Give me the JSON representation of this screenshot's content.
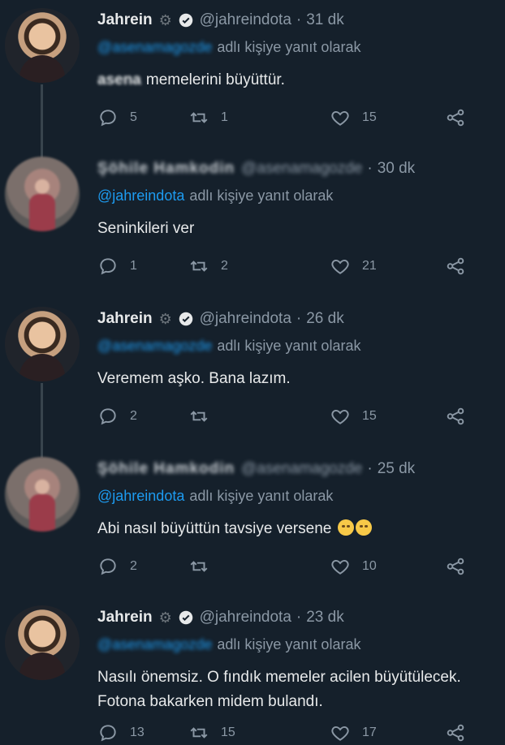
{
  "tweets": [
    {
      "author": "Jahrein",
      "handle": "@jahreindota",
      "time": "31 dk",
      "reply_to": "@asenamagozde",
      "reply_suffix": "adlı kişiye yanıt olarak",
      "text_prefix": "asena",
      "text": "memelerini büyüttür.",
      "replies": "5",
      "retweets": "1",
      "likes": "15"
    },
    {
      "author": "Şöhile Hamkodin",
      "handle": "@asenamagozde",
      "time": "30 dk",
      "reply_to": "@jahreindota",
      "reply_suffix": "adlı kişiye yanıt olarak",
      "text": "Seninkileri ver",
      "replies": "1",
      "retweets": "2",
      "likes": "21"
    },
    {
      "author": "Jahrein",
      "handle": "@jahreindota",
      "time": "26 dk",
      "reply_to": "@asenamagozde",
      "reply_suffix": "adlı kişiye yanıt olarak",
      "text": "Veremem aşko. Bana lazım.",
      "replies": "2",
      "retweets": "",
      "likes": "15"
    },
    {
      "author": "Şöhile Hamkodin",
      "handle": "@asenamagozde",
      "time": "25 dk",
      "reply_to": "@jahreindota",
      "reply_suffix": "adlı kişiye yanıt olarak",
      "text": "Abi nasıl büyüttün tavsiye versene",
      "replies": "2",
      "retweets": "",
      "likes": "10"
    },
    {
      "author": "Jahrein",
      "handle": "@jahreindota",
      "time": "23 dk",
      "reply_to": "@asenamagozde",
      "reply_suffix": "adlı kişiye yanıt olarak",
      "text_line1": "Nasılı önemsiz. O fındık memeler acilen büyütülecek.",
      "text_line2": "Fotona bakarken midem bulandı.",
      "replies": "13",
      "retweets": "15",
      "likes": "17"
    }
  ],
  "colors": {
    "background": "#15202b",
    "text": "#e7e9ea",
    "muted": "#8b98a5",
    "link": "#1d9bf0",
    "thread_line": "#38444d"
  },
  "icons": [
    "gear-icon",
    "verified-icon",
    "reply-icon",
    "retweet-icon",
    "like-icon",
    "share-icon",
    "emoji-icon"
  ]
}
